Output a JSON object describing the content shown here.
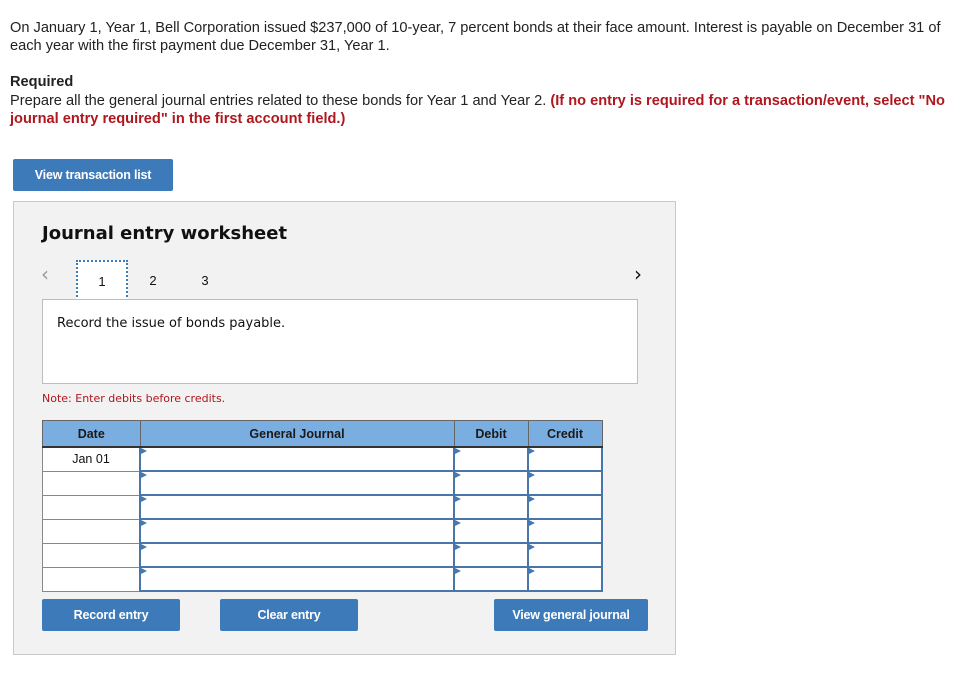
{
  "problem": {
    "intro": "On January 1, Year 1, Bell Corporation issued $237,000 of 10-year, 7 percent bonds at their face amount. Interest is payable on December 31 of each year with the first payment due December 31, Year 1.",
    "required_heading": "Required",
    "required_text": "Prepare all the general journal entries related to these bonds for Year 1 and Year 2.",
    "required_instruction": "(If no entry is required for a transaction/event, select \"No journal entry required\" in the first account field.)"
  },
  "buttons": {
    "view_transaction_list": "View transaction list",
    "record_entry": "Record entry",
    "clear_entry": "Clear entry",
    "view_general_journal": "View general journal"
  },
  "worksheet": {
    "title": "Journal entry worksheet",
    "nav_prev_icon": "‹",
    "nav_next_icon": "›",
    "tabs": [
      {
        "label": "1",
        "active": true
      },
      {
        "label": "2",
        "active": false
      },
      {
        "label": "3",
        "active": false
      }
    ],
    "description": "Record the issue of bonds payable.",
    "note": "Note: Enter debits before credits."
  },
  "journal_table": {
    "headers": [
      "Date",
      "General Journal",
      "Debit",
      "Credit"
    ],
    "rows": [
      {
        "date": "Jan 01",
        "account": "",
        "debit": "",
        "credit": ""
      },
      {
        "date": "",
        "account": "",
        "debit": "",
        "credit": ""
      },
      {
        "date": "",
        "account": "",
        "debit": "",
        "credit": ""
      },
      {
        "date": "",
        "account": "",
        "debit": "",
        "credit": ""
      },
      {
        "date": "",
        "account": "",
        "debit": "",
        "credit": ""
      },
      {
        "date": "",
        "account": "",
        "debit": "",
        "credit": ""
      }
    ]
  },
  "colors": {
    "button_blue": "#3d7ab9",
    "header_blue": "#7aaee0",
    "instruction_red": "#b0161e"
  }
}
